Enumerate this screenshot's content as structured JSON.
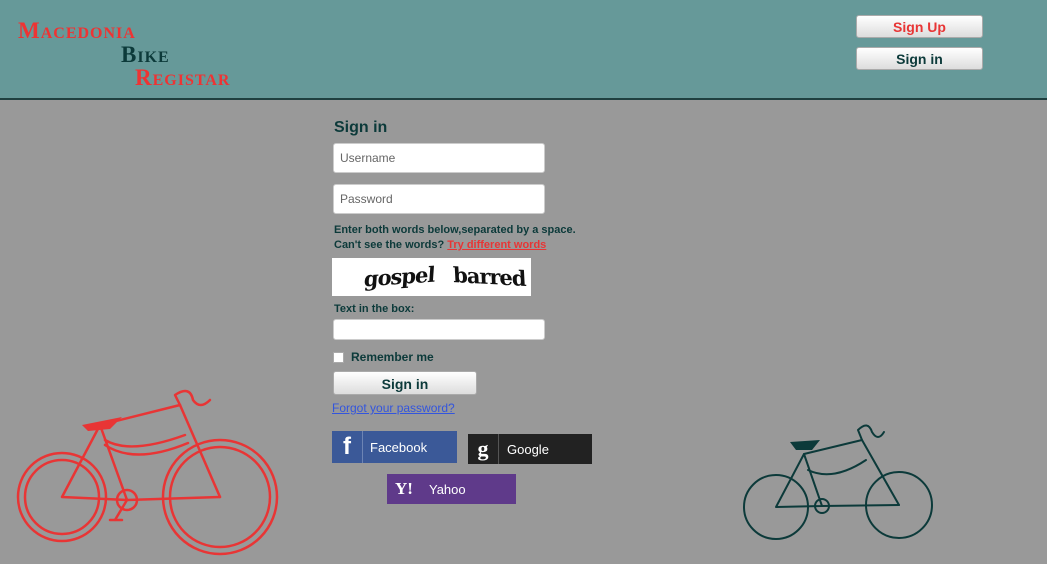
{
  "header": {
    "logo": [
      "Macedonia",
      "Bike",
      "Registar"
    ],
    "signup_label": "Sign Up",
    "signin_label": "Sign in"
  },
  "form": {
    "title": "Sign in",
    "username_placeholder": "Username",
    "password_placeholder": "Password",
    "captcha_instruction": "Enter both words below,separated by a space.",
    "captcha_cant_see": "Can't see the words?",
    "captcha_try_link": "Try different words",
    "captcha_words": [
      "gospel",
      "barred"
    ],
    "textbox_label": "Text in the box:",
    "remember_label": "Remember me",
    "signin_button": "Sign in",
    "forgot_link": "Forgot your password?"
  },
  "social": {
    "facebook_label": "Facebook",
    "google_label": "Google",
    "yahoo_label": "Yahoo"
  },
  "icons": {
    "facebook": "facebook-f-icon",
    "google": "google-g-icon",
    "yahoo": "yahoo-y-icon",
    "bike_left": "red-bicycle",
    "bike_right": "teal-bicycle"
  },
  "colors": {
    "header_bg": "#669999",
    "page_bg": "#999999",
    "accent_red": "#e83535",
    "dark_teal": "#0c3a3a",
    "facebook": "#3b5998",
    "google": "#222222",
    "yahoo": "#5f3a8a"
  }
}
